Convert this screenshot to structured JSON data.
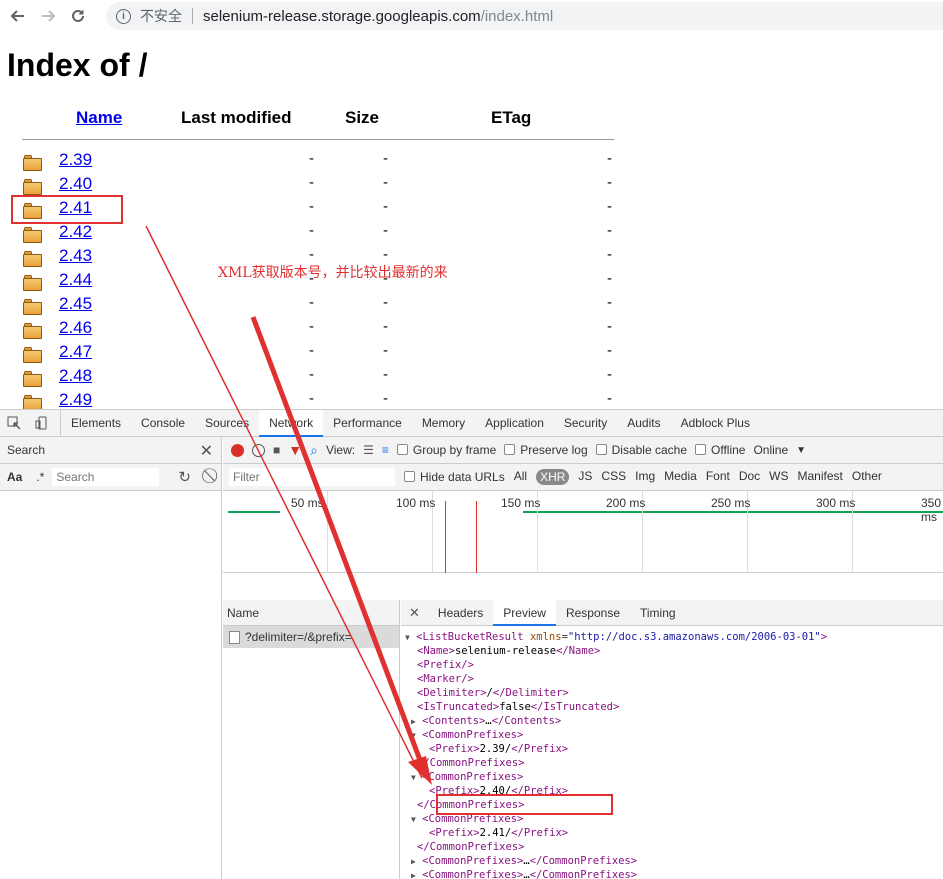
{
  "browser": {
    "insecure_label": "不安全",
    "url_host": "selenium-release.storage.googleapis.com",
    "url_path": "/index.html"
  },
  "page": {
    "title": "Index of /",
    "columns": [
      "Name",
      "Last modified",
      "Size",
      "ETag"
    ],
    "rows": [
      {
        "name": "2.39",
        "modified": "-",
        "size": "-",
        "etag": "-"
      },
      {
        "name": "2.40",
        "modified": "-",
        "size": "-",
        "etag": "-"
      },
      {
        "name": "2.41",
        "modified": "-",
        "size": "-",
        "etag": "-"
      },
      {
        "name": "2.42",
        "modified": "-",
        "size": "-",
        "etag": "-"
      },
      {
        "name": "2.43",
        "modified": "-",
        "size": "-",
        "etag": "-"
      },
      {
        "name": "2.44",
        "modified": "-",
        "size": "-",
        "etag": "-"
      },
      {
        "name": "2.45",
        "modified": "-",
        "size": "-",
        "etag": "-"
      },
      {
        "name": "2.46",
        "modified": "-",
        "size": "-",
        "etag": "-"
      },
      {
        "name": "2.47",
        "modified": "-",
        "size": "-",
        "etag": "-"
      },
      {
        "name": "2.48",
        "modified": "-",
        "size": "-",
        "etag": "-"
      },
      {
        "name": "2.49",
        "modified": "-",
        "size": "-",
        "etag": "-"
      }
    ],
    "annotation": "XML获取版本号，并比较出最新的来"
  },
  "devtools": {
    "tabs": [
      "Elements",
      "Console",
      "Sources",
      "Network",
      "Performance",
      "Memory",
      "Application",
      "Security",
      "Audits",
      "Adblock Plus"
    ],
    "active_tab": "Network",
    "search_title": "Search",
    "search_aa": "Aa",
    "search_regex": ".*",
    "search_placeholder": "Search",
    "toolbar": {
      "view_label": "View:",
      "group_by_frame": "Group by frame",
      "preserve_log": "Preserve log",
      "disable_cache": "Disable cache",
      "offline": "Offline",
      "online": "Online"
    },
    "filter": {
      "placeholder": "Filter",
      "hide_data_urls": "Hide data URLs",
      "types": [
        "All",
        "XHR",
        "JS",
        "CSS",
        "Img",
        "Media",
        "Font",
        "Doc",
        "WS",
        "Manifest",
        "Other"
      ],
      "active_type": "XHR"
    },
    "timeline_ticks": [
      "50 ms",
      "100 ms",
      "150 ms",
      "200 ms",
      "250 ms",
      "300 ms",
      "350 ms"
    ],
    "name_header": "Name",
    "request_name": "?delimiter=/&prefix=",
    "detail_tabs": [
      "Headers",
      "Preview",
      "Response",
      "Timing"
    ],
    "detail_active": "Preview",
    "xml": {
      "root_open": "ListBucketResult",
      "xmlns_attr": "xmlns",
      "xmlns_val": "\"http://doc.s3.amazonaws.com/2006-03-01\"",
      "name_val": "selenium-release",
      "delimiter_val": "/",
      "truncated_val": "false",
      "prefixes": [
        "2.39/",
        "2.40/",
        "2.41/"
      ]
    }
  },
  "colors": {
    "link": "#0000ee",
    "annotation_red": "#e03030",
    "xml_tag": "#881280",
    "xml_attr": "#994500",
    "xml_value": "#1a1aa6",
    "devtools_active": "#1a73e8"
  }
}
